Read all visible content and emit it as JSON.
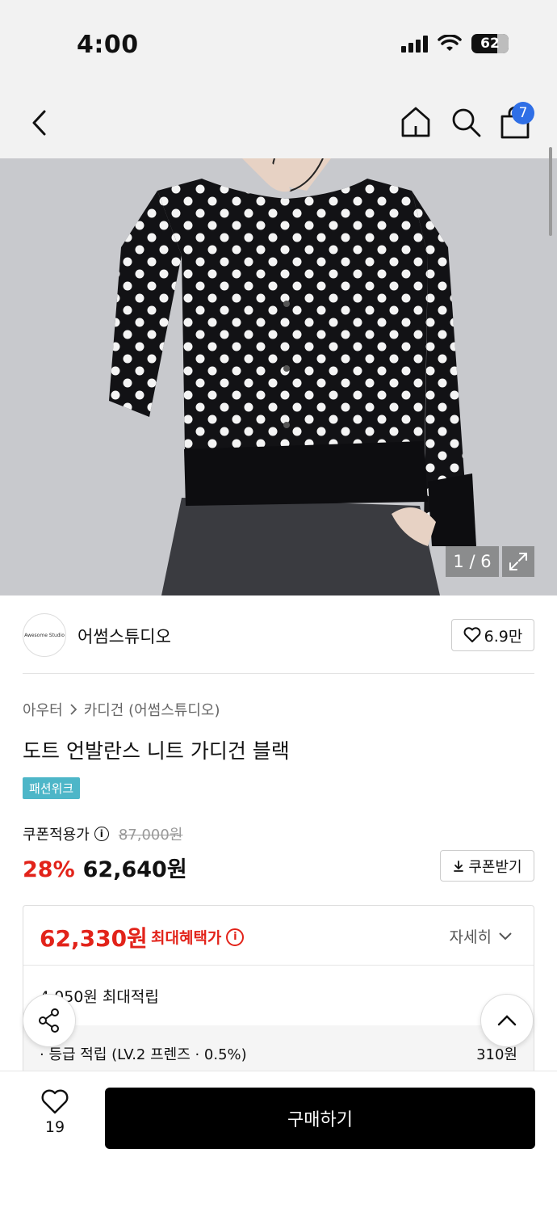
{
  "status_bar": {
    "time": "4:00",
    "battery": "62"
  },
  "nav": {
    "cart_count": "7"
  },
  "image": {
    "counter": "1 / 6"
  },
  "brand": {
    "name": "어썸스튜디오",
    "logo_text": "Awesome Studio",
    "likes": "6.9만"
  },
  "breadcrumb": {
    "category": "아우터",
    "subcategory": "카디건 (어썸스튜디오)"
  },
  "product": {
    "title": "도트 언발란스 니트 가디건 블랙",
    "tag": "패션위크",
    "coupon_label": "쿠폰적용가",
    "original_price": "87,000원",
    "discount": "28%",
    "price": "62,640원",
    "coupon_button": "쿠폰받기"
  },
  "benefit": {
    "max_price": "62,330원",
    "max_label": "최대혜택가",
    "detail": "자세히",
    "points": "4,050원 최대적립",
    "grade_label": "· 등급 적립 (LV.2 프렌즈 · 0.5%)",
    "grade_value": "310원"
  },
  "bottom": {
    "likes": "19",
    "buy_label": "구매하기"
  },
  "colors": {
    "accent_red": "#e2231a",
    "badge_blue": "#2f6fe6",
    "tag_teal": "#4db6c8"
  }
}
